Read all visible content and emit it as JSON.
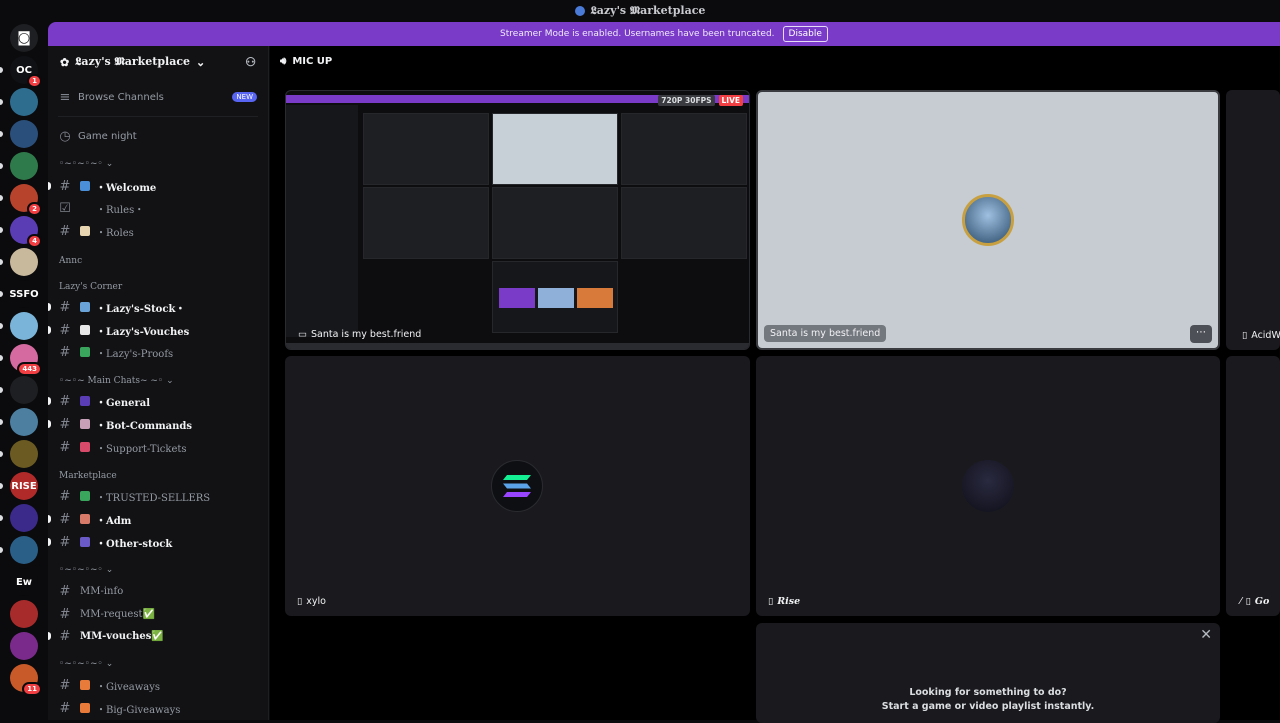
{
  "window": {
    "title": "𝕷azy's 𝕸arketplace"
  },
  "banner": {
    "text": "Streamer Mode is enabled. Usernames have been truncated.",
    "button": "Disable"
  },
  "servers": [
    {
      "label": "",
      "color": "#1e1f22",
      "badge": ""
    },
    {
      "label": "OC",
      "color": "#101114",
      "badge": "1"
    },
    {
      "label": "",
      "color": "#2f6d8f",
      "badge": ""
    },
    {
      "label": "",
      "color": "#2a4f7a",
      "badge": ""
    },
    {
      "label": "",
      "color": "#2f7a4a",
      "badge": ""
    },
    {
      "label": "",
      "color": "#b8432d",
      "badge": "2"
    },
    {
      "label": "",
      "color": "#5a3db5",
      "badge": "4"
    },
    {
      "label": "",
      "color": "#c8b89c",
      "badge": ""
    },
    {
      "label": "SSFO",
      "color": "#0b0b0d",
      "badge": ""
    },
    {
      "label": "",
      "color": "#7ab4d8",
      "badge": ""
    },
    {
      "label": "",
      "color": "#d46aa0",
      "badge": "443"
    },
    {
      "label": "",
      "color": "#1e1f22",
      "badge": ""
    },
    {
      "label": "",
      "color": "#4c7fa0",
      "badge": ""
    },
    {
      "label": "",
      "color": "#6b5b22",
      "badge": ""
    },
    {
      "label": "RISE",
      "color": "#b02a2a",
      "badge": ""
    },
    {
      "label": "",
      "color": "#3b2a8a",
      "badge": ""
    },
    {
      "label": "",
      "color": "#2a5f88",
      "badge": ""
    },
    {
      "label": "Ew",
      "color": "#0b0b0d",
      "badge": ""
    },
    {
      "label": "",
      "color": "#a82b2b",
      "badge": ""
    },
    {
      "label": "",
      "color": "#7a2a8a",
      "badge": ""
    },
    {
      "label": "",
      "color": "#c85a2a",
      "badge": "11"
    }
  ],
  "sidebar": {
    "server_name": "𝕷azy's 𝕸arketplace",
    "browse": "Browse Channels",
    "new_tag": "NEW",
    "game_night": "Game night",
    "cat1": "◦~◦~◦~◦ ⌄",
    "cat_annc": "Annc",
    "cat_corner": "Lazy's Corner",
    "cat_main": "◦~◦~ Main Chats~ ~◦ ⌄",
    "cat_market": "Marketplace",
    "cat_mm": "◦~◦~◦~◦ ⌄",
    "cat_give": "◦~◦~◦~◦ ⌄",
    "channels": [
      {
        "label": "・Welcome"
      },
      {
        "label": "・Rules・"
      },
      {
        "label": "・Roles"
      },
      {
        "label": "・Lazy's-Stock・"
      },
      {
        "label": "・Lazy's-Vouches"
      },
      {
        "label": "・Lazy's-Proofs"
      },
      {
        "label": "・General"
      },
      {
        "label": "・Bot-Commands"
      },
      {
        "label": "・Support-Tickets"
      },
      {
        "label": "・TRUSTED-SELLERS"
      },
      {
        "label": "・Adm"
      },
      {
        "label": "・Other-stock"
      },
      {
        "label": "MM-info"
      },
      {
        "label": "MM-request✅"
      },
      {
        "label": "MM-vouches✅"
      },
      {
        "label": "・Giveaways"
      },
      {
        "label": "・Big-Giveaways"
      }
    ]
  },
  "voice": {
    "channel": "MIC UP",
    "stream_quality": "720P 30FPS",
    "live": "LIVE",
    "tiles": [
      {
        "name": "Santa is my best.friend"
      },
      {
        "name": "Santa is my best.friend"
      },
      {
        "name": "AcidW"
      },
      {
        "name": "xylo"
      },
      {
        "name": "Rise"
      },
      {
        "name": "Go"
      }
    ],
    "activity_line1": "Looking for something to do?",
    "activity_line2": "Start a game or video playlist instantly."
  },
  "colors": {
    "accent": "#7a3cc8",
    "blurple": "#5865f2",
    "live": "#f23f43"
  }
}
